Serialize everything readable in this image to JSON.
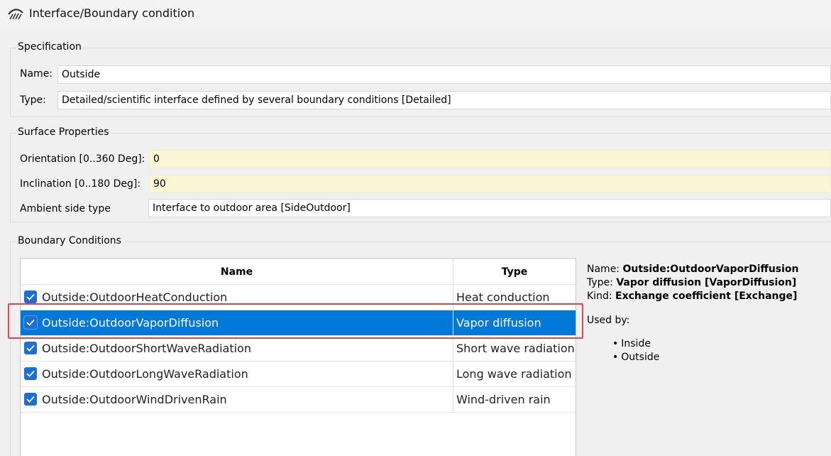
{
  "window": {
    "title": "Interface/Boundary condition"
  },
  "specification": {
    "group_label": "Specification",
    "name_label": "Name:",
    "name_value": "Outside",
    "type_label": "Type:",
    "type_value": "Detailed/scientific interface defined by several boundary conditions [Detailed]"
  },
  "surface": {
    "group_label": "Surface Properties",
    "orientation_label": "Orientation [0..360 Deg]:",
    "orientation_value": "0",
    "inclination_label": "Inclination [0..180 Deg]:",
    "inclination_value": "90",
    "ambient_label": "Ambient side type",
    "ambient_value": "Interface to outdoor area [SideOutdoor]"
  },
  "boundary": {
    "group_label": "Boundary Conditions",
    "columns": [
      "Name",
      "Type"
    ],
    "rows": [
      {
        "name": "Outside:OutdoorHeatConduction",
        "type": "Heat conduction",
        "checked": true,
        "selected": false
      },
      {
        "name": "Outside:OutdoorVaporDiffusion",
        "type": "Vapor diffusion",
        "checked": true,
        "selected": true
      },
      {
        "name": "Outside:OutdoorShortWaveRadiation",
        "type": "Short wave radiation",
        "checked": true,
        "selected": false
      },
      {
        "name": "Outside:OutdoorLongWaveRadiation",
        "type": "Long wave radiation",
        "checked": true,
        "selected": false
      },
      {
        "name": "Outside:OutdoorWindDrivenRain",
        "type": "Wind-driven rain",
        "checked": true,
        "selected": false
      }
    ]
  },
  "details": {
    "name_label": "Name:",
    "name_value": "Outside:OutdoorVaporDiffusion",
    "type_label": "Type:",
    "type_value": "Vapor diffusion [VaporDiffusion]",
    "kind_label": "Kind:",
    "kind_value": "Exchange coefficient [Exchange]",
    "used_by_label": "Used by:",
    "used_by": [
      "Inside",
      "Outside"
    ]
  },
  "colors": {
    "selection": "#0078d7",
    "checkbox": "#1f6fd2",
    "highlight_outline": "#e0484d",
    "editable_field": "#fbf7d4"
  }
}
